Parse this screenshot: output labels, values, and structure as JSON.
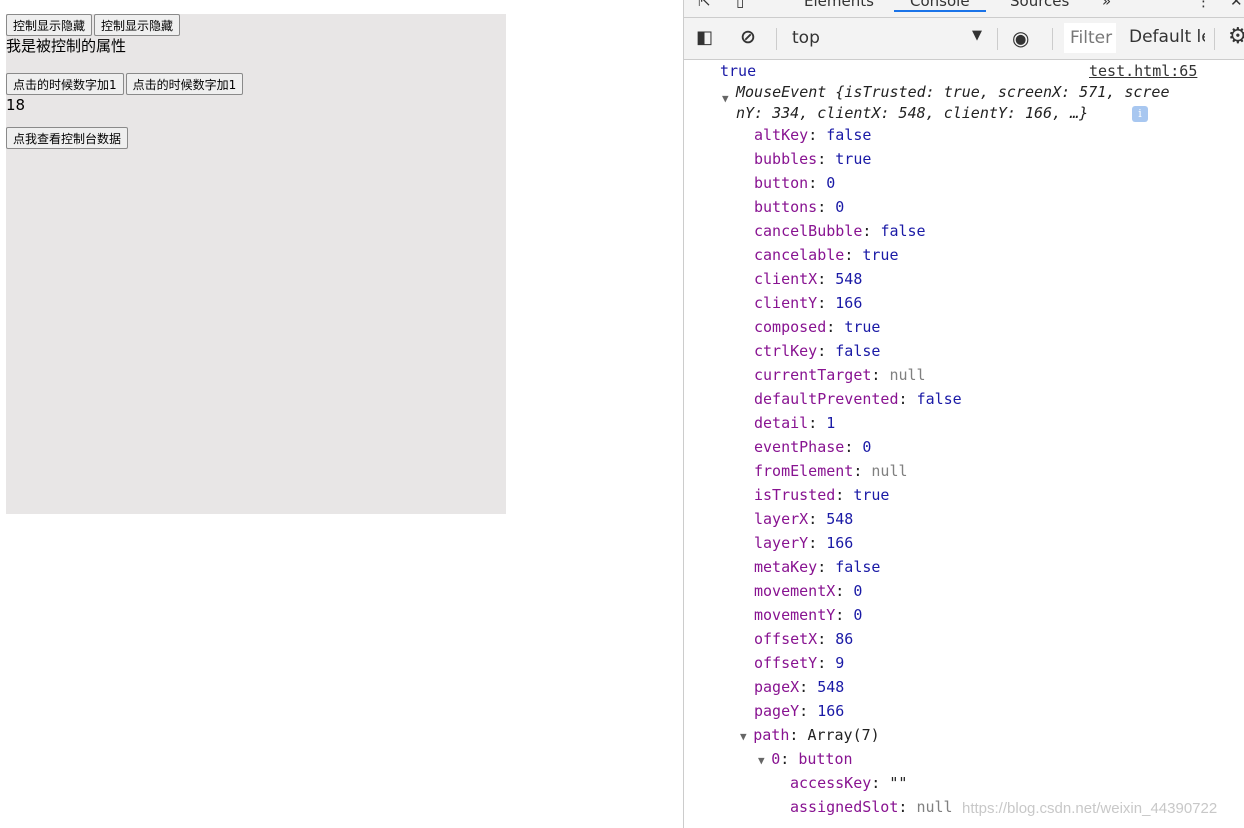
{
  "page": {
    "toggle_buttons": [
      "控制显示隐藏",
      "控制显示隐藏"
    ],
    "controlled_text": "我是被控制的属性",
    "increment_buttons": [
      "点击的时候数字加1",
      "点击的时候数字加1"
    ],
    "count": "18",
    "console_button": "点我查看控制台数据"
  },
  "devtools": {
    "tabs": [
      "Elements",
      "Console",
      "Sources",
      "»"
    ],
    "active_tab": "Console",
    "context": "top",
    "filter_placeholder": "Filter",
    "levels": "Default le",
    "log_value": "true",
    "log_source": "test.html:65",
    "event_summary_1": "MouseEvent {isTrusted: true, screenX: 571, scree",
    "event_summary_2": "nY: 334, clientX: 548, clientY: 166, …}",
    "properties": [
      {
        "k": "altKey",
        "v": "false",
        "t": "v"
      },
      {
        "k": "bubbles",
        "v": "true",
        "t": "v"
      },
      {
        "k": "button",
        "v": "0",
        "t": "v"
      },
      {
        "k": "buttons",
        "v": "0",
        "t": "v"
      },
      {
        "k": "cancelBubble",
        "v": "false",
        "t": "v"
      },
      {
        "k": "cancelable",
        "v": "true",
        "t": "v"
      },
      {
        "k": "clientX",
        "v": "548",
        "t": "v"
      },
      {
        "k": "clientY",
        "v": "166",
        "t": "v"
      },
      {
        "k": "composed",
        "v": "true",
        "t": "v"
      },
      {
        "k": "ctrlKey",
        "v": "false",
        "t": "v"
      },
      {
        "k": "currentTarget",
        "v": "null",
        "t": "n"
      },
      {
        "k": "defaultPrevented",
        "v": "false",
        "t": "v"
      },
      {
        "k": "detail",
        "v": "1",
        "t": "v"
      },
      {
        "k": "eventPhase",
        "v": "0",
        "t": "v"
      },
      {
        "k": "fromElement",
        "v": "null",
        "t": "n"
      },
      {
        "k": "isTrusted",
        "v": "true",
        "t": "v"
      },
      {
        "k": "layerX",
        "v": "548",
        "t": "v"
      },
      {
        "k": "layerY",
        "v": "166",
        "t": "v"
      },
      {
        "k": "metaKey",
        "v": "false",
        "t": "v"
      },
      {
        "k": "movementX",
        "v": "0",
        "t": "v"
      },
      {
        "k": "movementY",
        "v": "0",
        "t": "v"
      },
      {
        "k": "offsetX",
        "v": "86",
        "t": "v"
      },
      {
        "k": "offsetY",
        "v": "9",
        "t": "v"
      },
      {
        "k": "pageX",
        "v": "548",
        "t": "v"
      },
      {
        "k": "pageY",
        "v": "166",
        "t": "v"
      }
    ],
    "path": {
      "k": "path",
      "v": "Array(7)"
    },
    "path_item": {
      "k": "0",
      "v": "button"
    },
    "button_props": [
      {
        "k": "accessKey",
        "v": "\"\"",
        "t": "p"
      },
      {
        "k": "assignedSlot",
        "v": "null",
        "t": "n"
      }
    ]
  },
  "watermark": "https://blog.csdn.net/weixin_44390722"
}
